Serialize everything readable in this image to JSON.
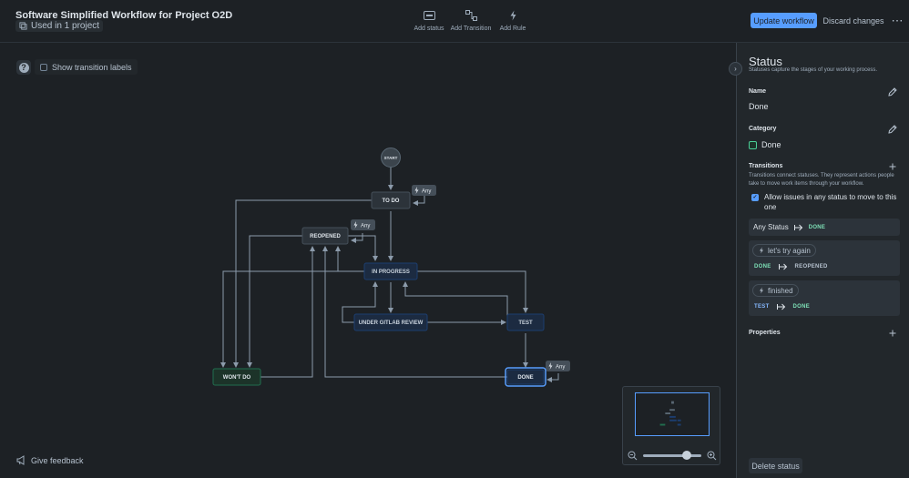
{
  "header": {
    "title": "Software Simplified Workflow for Project O2D",
    "used_in": "Used in 1 project",
    "tools": [
      {
        "label": "Add status",
        "icon": "add-status-icon"
      },
      {
        "label": "Add Transition",
        "icon": "add-transition-icon"
      },
      {
        "label": "Add Rule",
        "icon": "add-rule-icon"
      }
    ],
    "update_label": "Update workflow",
    "discard_label": "Discard changes",
    "more_icon": "more-icon"
  },
  "canvas": {
    "show_labels": "Show transition labels",
    "show_labels_checked": false,
    "feedback": "Give feedback",
    "zoom_level": 0.75
  },
  "diagram": {
    "start": "START",
    "any_label": "Any",
    "statuses": {
      "todo": "TO DO",
      "reopened": "REOPENED",
      "in_progress": "IN PROGRESS",
      "under_review": "UNDER GITLAB REVIEW",
      "test": "TEST",
      "wont_do": "WON'T DO",
      "done": "DONE"
    },
    "colors": {
      "blue_fill": "#1c2b41",
      "blue_border": "#1c3e70",
      "green_fill": "#1c3329",
      "green_border": "#216e4e",
      "grey_fill": "#2c333a",
      "grey_border": "#454f59",
      "line": "#8c9bab",
      "selected": "#579dff"
    }
  },
  "panel": {
    "title": "Status",
    "subtitle": "Statuses capture the stages of your working process.",
    "name_label": "Name",
    "name_value": "Done",
    "category_label": "Category",
    "category_value": "Done",
    "transitions_label": "Transitions",
    "transitions_desc": "Transitions connect statuses. They represent actions people take to move work items through your workflow.",
    "allow_any": "Allow issues in any status to move to this one",
    "allow_any_checked": true,
    "any_status": "Any Status",
    "any_target": "DONE",
    "transitions": [
      {
        "name": "let's try again",
        "from": "DONE",
        "to": "REOPENED"
      },
      {
        "name": "finished",
        "from": "TEST",
        "to": "DONE"
      }
    ],
    "properties_label": "Properties",
    "delete_label": "Delete status"
  }
}
